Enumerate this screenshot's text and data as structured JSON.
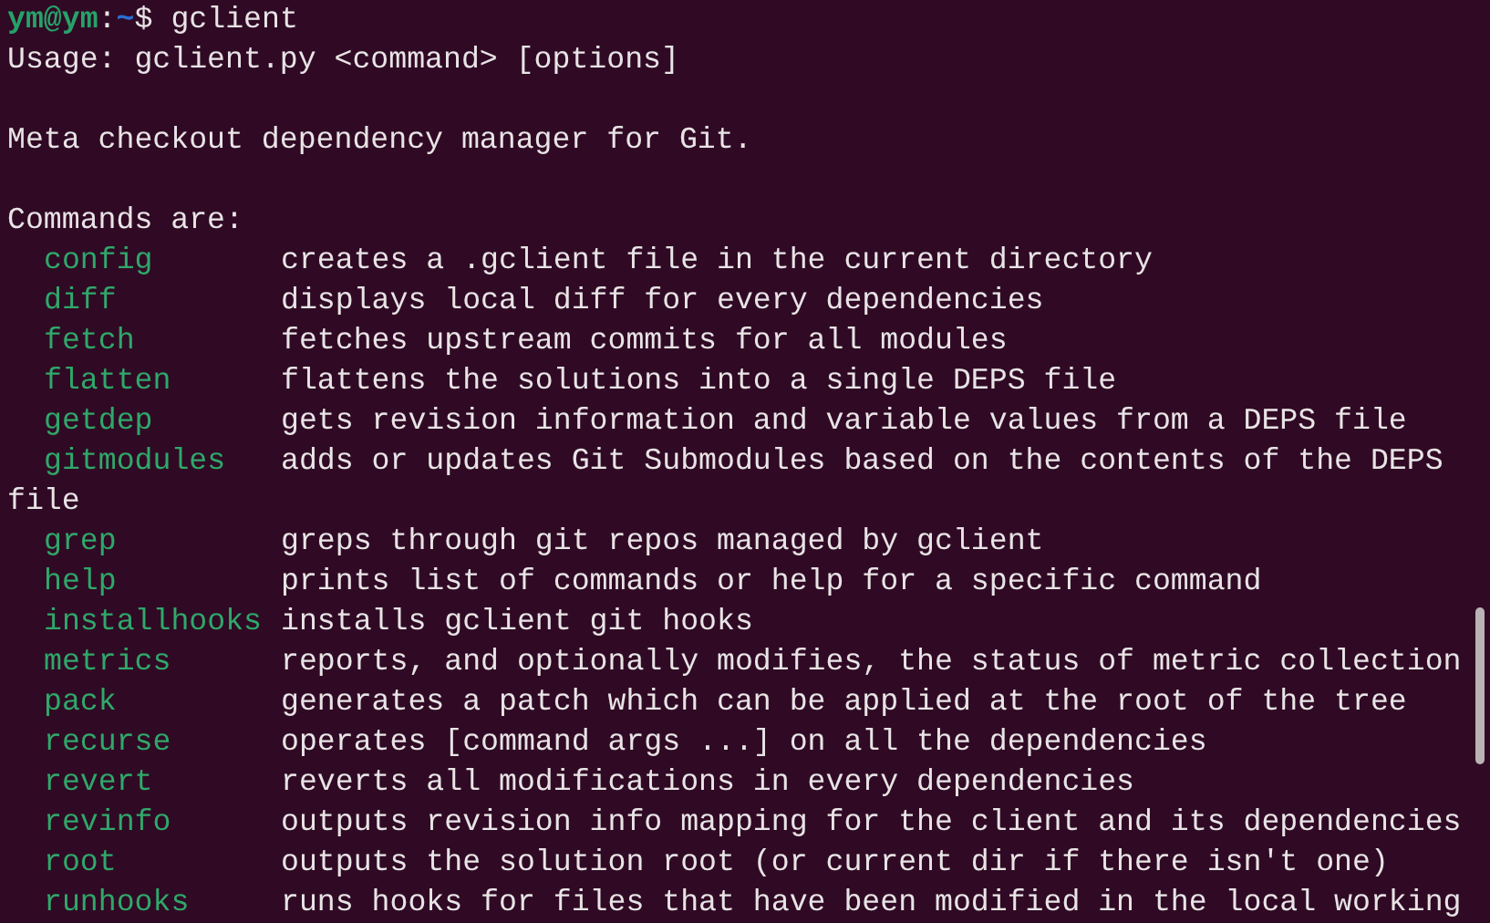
{
  "prompt": {
    "user_host": "ym@ym",
    "separator": ":",
    "path": "~",
    "symbol": "$",
    "command": "gclient"
  },
  "usage": "Usage: gclient.py <command> [options]",
  "description": "Meta checkout dependency manager for Git.",
  "commands_heading": "Commands are:",
  "commands": [
    {
      "name": "config",
      "description": "creates a .gclient file in the current directory"
    },
    {
      "name": "diff",
      "description": "displays local diff for every dependencies"
    },
    {
      "name": "fetch",
      "description": "fetches upstream commits for all modules"
    },
    {
      "name": "flatten",
      "description": "flattens the solutions into a single DEPS file"
    },
    {
      "name": "getdep",
      "description": "gets revision information and variable values from a DEPS file"
    },
    {
      "name": "gitmodules",
      "description": "adds or updates Git Submodules based on the contents of the DEPS",
      "wrapped_line": "file"
    },
    {
      "name": "grep",
      "description": "greps through git repos managed by gclient"
    },
    {
      "name": "help",
      "description": "prints list of commands or help for a specific command"
    },
    {
      "name": "installhooks",
      "description": "installs gclient git hooks"
    },
    {
      "name": "metrics",
      "description": "reports, and optionally modifies, the status of metric collection"
    },
    {
      "name": "pack",
      "description": "generates a patch which can be applied at the root of the tree"
    },
    {
      "name": "recurse",
      "description": "operates [command args ...] on all the dependencies"
    },
    {
      "name": "revert",
      "description": "reverts all modifications in every dependencies"
    },
    {
      "name": "revinfo",
      "description": "outputs revision info mapping for the client and its dependencies"
    },
    {
      "name": "root",
      "description": "outputs the solution root (or current dir if there isn't one)"
    },
    {
      "name": "runhooks",
      "description": "runs hooks for files that have been modified in the local working"
    }
  ]
}
